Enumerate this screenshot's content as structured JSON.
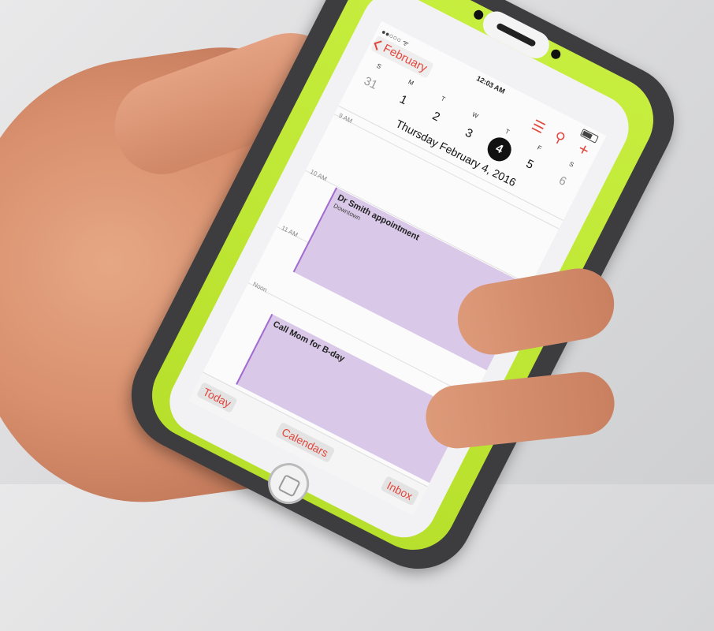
{
  "scene": "hand-holding-phone-calendar",
  "status_bar": {
    "carrier": "●●○○○ ᯤ",
    "time": "12:03 AM"
  },
  "nav": {
    "back_label": "February",
    "list_icon": "list-icon",
    "search_icon": "search-icon",
    "add_icon": "plus-icon"
  },
  "week": {
    "weekdays": [
      "S",
      "M",
      "T",
      "W",
      "T",
      "F",
      "S"
    ],
    "dates": [
      "31",
      "1",
      "2",
      "3",
      "4",
      "5",
      "6"
    ],
    "selected_index": 4
  },
  "full_date": "Thursday  February 4, 2016",
  "timeline": {
    "hours": [
      "9 AM",
      "10 AM",
      "11 AM",
      "Noon"
    ]
  },
  "events": [
    {
      "title": "Dr Smith appointment",
      "location": "Downtown"
    },
    {
      "title": "Call Mom for B-day",
      "location": ""
    }
  ],
  "tabbar": {
    "today": "Today",
    "calendars": "Calendars",
    "inbox": "Inbox"
  },
  "colors": {
    "accent": "#e2473d",
    "event_fill": "#d9c8e8",
    "case_green": "#c7ee3e",
    "case_dark": "#3d3d3f"
  }
}
